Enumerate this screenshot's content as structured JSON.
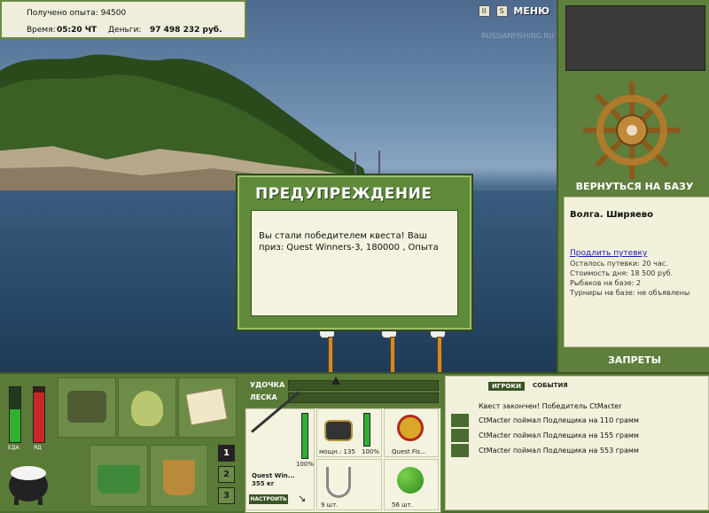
{
  "stats": {
    "xp_label": "Получено опыта: 94500",
    "time_label": "Время:",
    "time_value": "05:20 ЧТ",
    "money_label": "Деньги:",
    "money_value": "97 498 232 руб."
  },
  "toolbar": {
    "pause": "II",
    "settings": "S",
    "menu": "МЕНЮ"
  },
  "watermark": "RUSSIANFISHING.RU",
  "right_panel": {
    "back_to_base": "ВЕРНУТЬСЯ НА БАЗУ",
    "location": "Волга. Ширяево",
    "extend_link": "Продлить путевку",
    "trip_left": "Осталось путевки: 20 час.",
    "day_cost": "Стоимость дня: 18 500 руб.",
    "fishers": "Рыбаков на базе: 2",
    "tournaments": "Турниры на базе: не объявлены",
    "bans": "ЗАПРЕТЫ"
  },
  "dialog": {
    "title": "ПРЕДУПРЕЖДЕНИЕ",
    "message": "Вы стали победителем квеста! Ваш приз: Quest Winners-3, 180000 , Опыта"
  },
  "bottom": {
    "food_label": "ЕДА",
    "poison_label": "ЯД",
    "rod_label": "УДОЧКА",
    "line_label": "ЛЕСКА",
    "rod_name": "Quest Win...",
    "rod_weight": "355 кг",
    "rod_percent": "100%",
    "setup_button": "НАСТРОИТЬ",
    "reel_label": "мощн.: 135",
    "reel_percent": "100%",
    "line_name": "Quest Fis...",
    "hooks_count": "9 шт.",
    "bait_count": "56 шт.",
    "set_buttons": [
      "1",
      "2",
      "3"
    ]
  },
  "events": {
    "tab_players": "ИГРОКИ",
    "tab_events": "СОБЫТИЯ",
    "quest_done": "Квест закончен! Победитель CtMacter",
    "items": [
      "CtMacter поймал Подлещика на 110 грамм",
      "CtMacter поймал Подлещика на 155 грамм",
      "CtMacter поймал Подлещика на 553 грамм"
    ]
  },
  "colors": {
    "panel_green": "#5f7f3d",
    "dialog_green": "#5e8a3a",
    "cream": "#f3f3df",
    "link_blue": "#1a1ab5"
  }
}
